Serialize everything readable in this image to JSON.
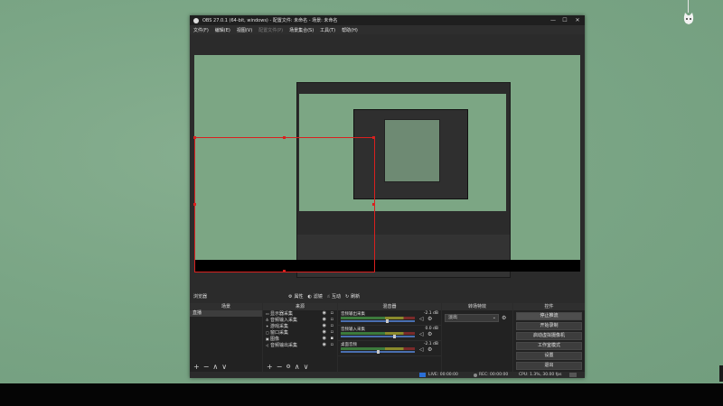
{
  "window": {
    "title": "OBS 27.0.1 (64-bit, windows) - 配置文件: 未命名 - 场景: 未命名",
    "controls": {
      "minimize": "—",
      "maximize": "☐",
      "close": "✕"
    }
  },
  "menu": [
    "文件(F)",
    "编辑(E)",
    "视图(V)",
    "配置文件(P)",
    "场景集合(S)",
    "工具(T)",
    "帮助(H)"
  ],
  "toolbar": {
    "label": "浏览器",
    "buttons": [
      {
        "icon": "gear-icon",
        "label": "属性"
      },
      {
        "icon": "filter-icon",
        "label": "滤镜"
      },
      {
        "icon": "interact-icon",
        "label": "互动"
      },
      {
        "icon": "refresh-icon",
        "label": "刷新"
      }
    ]
  },
  "scenes": {
    "header": "场景",
    "items": [
      "直播"
    ],
    "footer": [
      "+",
      "−",
      "∧",
      "∨"
    ]
  },
  "sources": {
    "header": "来源",
    "items": [
      {
        "icon": "monitor-icon",
        "label": "显示器采集"
      },
      {
        "icon": "mic-icon",
        "label": "音频输入采集"
      },
      {
        "icon": "gamepad-icon",
        "label": "游戏采集"
      },
      {
        "icon": "window-icon",
        "label": "窗口采集"
      },
      {
        "icon": "image-icon",
        "label": "图像"
      },
      {
        "icon": "speaker-icon",
        "label": "音频输出采集"
      }
    ],
    "footer": [
      "+",
      "−",
      "⚙",
      "∧",
      "∨"
    ]
  },
  "mixer": {
    "header": "混音器",
    "channels": [
      {
        "name": "音频输出采集",
        "db": "-2.1 dB",
        "level": 0.63
      },
      {
        "name": "音频输入采集",
        "db": "0.0 dB",
        "level": 0.72
      },
      {
        "name": "桌面音频",
        "db": "-2.1 dB",
        "level": 0.5
      }
    ]
  },
  "transitions": {
    "header": "转场特效",
    "selected": "淡出"
  },
  "controls": {
    "header": "控件",
    "buttons": [
      "停止推流",
      "开始录制",
      "启动虚拟摄像机",
      "工作室模式",
      "设置",
      "退出"
    ]
  },
  "status": {
    "live": "LIVE: 00:00:00",
    "rec": "REC: 00:00:00",
    "cpu": "CPU: 1.3%, 30.00 fps"
  },
  "colors": {
    "accent_red": "#d9201f",
    "dock_bg": "#222222",
    "window_bg": "#2b2b2b",
    "desktop_green": "#7fa98a"
  }
}
